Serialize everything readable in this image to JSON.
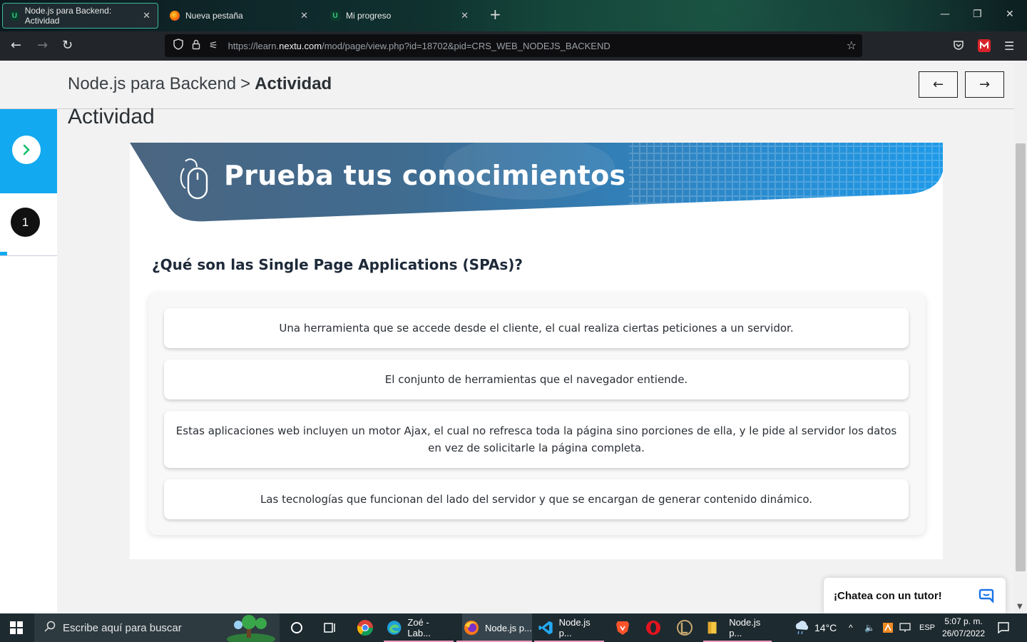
{
  "browser": {
    "tabs": [
      {
        "title": "Node.js para Backend: Actividad",
        "favicon": "nextu-u-icon",
        "active": true
      },
      {
        "title": "Nueva pestaña",
        "favicon": "firefox-icon",
        "active": false
      },
      {
        "title": "Mi progreso",
        "favicon": "nextu-u-icon",
        "active": false
      }
    ],
    "url": {
      "prefix": "https://learn.",
      "domain": "nextu.com",
      "path": "/mod/page/view.php?id=18702&pid=CRS_WEB_NODEJS_BACKEND"
    }
  },
  "header": {
    "course": "Node.js para Backend",
    "separator": ">",
    "current": "Actividad"
  },
  "sidebar": {
    "step_number": "1",
    "accent": "#12a9f0"
  },
  "main": {
    "page_title": "Actividad",
    "banner_title": "Prueba tus conocimientos",
    "question": "¿Qué son las Single Page Applications (SPAs)?",
    "options": [
      "Una herramienta que se accede desde el cliente, el cual realiza ciertas peticiones a un servidor.",
      "El conjunto de herramientas que el navegador entiende.",
      "Estas aplicaciones web incluyen un motor Ajax, el cual no refresca toda la página sino porciones de ella, y le pide al servidor los datos en vez de solicitarle la página completa.",
      "Las tecnologías que funcionan del lado del  servidor y que se encargan de generar contenido dinámico."
    ]
  },
  "chat": {
    "label": "¡Chatea con un tutor!"
  },
  "taskbar": {
    "search_placeholder": "Escribe aquí para buscar",
    "apps": [
      {
        "label": "Zoé - Lab...",
        "icon": "edge-icon"
      },
      {
        "label": "Node.js p...",
        "icon": "firefox-icon"
      },
      {
        "label": "Node.js p...",
        "icon": "vscode-icon"
      },
      {
        "label": "Node.js p...",
        "icon": "file-explorer-icon"
      }
    ],
    "weather": "14°C",
    "language": "ESP",
    "time": "5:07 p. m.",
    "date": "26/07/2022"
  }
}
